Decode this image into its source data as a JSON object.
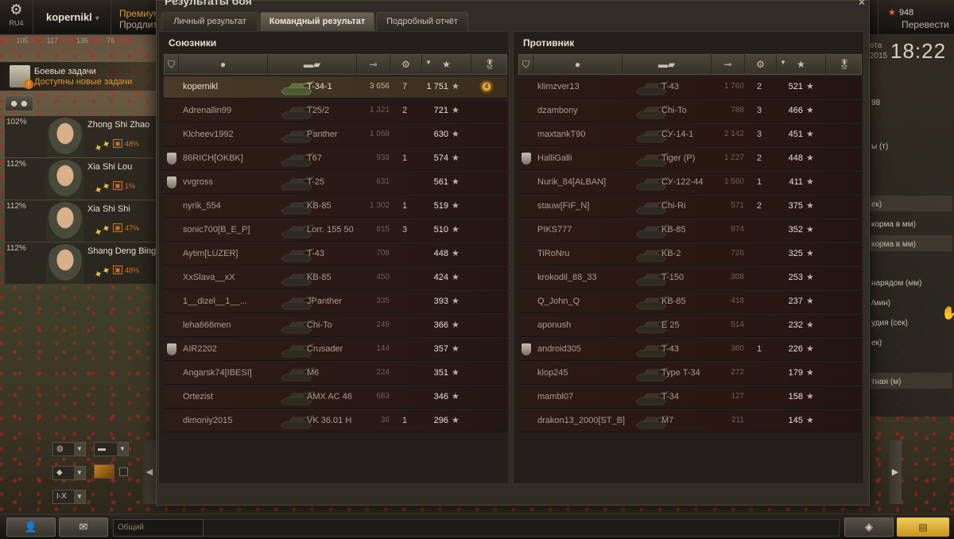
{
  "topbar": {
    "server_short": "RU4",
    "account_name": "kopernikl",
    "premium_title": "Премиум",
    "premium_sub": "Продлить",
    "gold_amount": "948",
    "convert_label": "Перевести"
  },
  "server_line": [
    "RU1",
    "105",
    "RU2",
    "117",
    "RU3",
    "136",
    "RU4",
    "76",
    "RU5"
  ],
  "missions": {
    "title": "Боевые задачи",
    "subtitle": "Доступны новые задачи",
    "badge": "!"
  },
  "crew": [
    {
      "pct": "102%",
      "name": "Zhong Shi Zhao",
      "skill": "48%"
    },
    {
      "pct": "112%",
      "name": "Xia Shi Lou",
      "skill": "1%"
    },
    {
      "pct": "112%",
      "name": "Xia Shi Shi",
      "skill": "47%"
    },
    {
      "pct": "112%",
      "name": "Shang Deng Bing",
      "skill": "48%"
    }
  ],
  "filters": {
    "level": "I-X"
  },
  "right_panel": {
    "clock_label": "ота",
    "clock_year": "2015",
    "clock": "18:22",
    "lines": [
      "98",
      "ы (т)",
      "ек)",
      "корма в мм)",
      "корма в мм)",
      "нарядом (мм)",
      "/мин)",
      "удия (сек)",
      "ек)",
      "тная (м)"
    ]
  },
  "bottombar": {
    "chat_placeholder": "Общий"
  },
  "window": {
    "title": "Результаты боя",
    "tabs": [
      "Личный результат",
      "Командный результат",
      "Подробный отчёт"
    ],
    "active_tab": 1
  },
  "allies": {
    "title": "Союзники",
    "rows": [
      {
        "player": "kopernikl",
        "tank": "T-34-1",
        "damage": "3 656",
        "kills": "7",
        "xp": "1 751",
        "clan_icon": false,
        "me": true,
        "medal": "4"
      },
      {
        "player": "Adrenallin99",
        "tank": "T25/2",
        "damage": "1 321",
        "kills": "2",
        "xp": "721",
        "clan_icon": false
      },
      {
        "player": "Klcheev1992",
        "tank": "Panther",
        "damage": "1 068",
        "kills": "",
        "xp": "630",
        "clan_icon": false
      },
      {
        "player": "86RICH[OKBK]",
        "tank": "T67",
        "damage": "938",
        "kills": "1",
        "xp": "574",
        "clan_icon": true
      },
      {
        "player": "vvgross",
        "tank": "T-25",
        "damage": "631",
        "kills": "",
        "xp": "561",
        "clan_icon": true
      },
      {
        "player": "nyrik_554",
        "tank": "KB-85",
        "damage": "1 302",
        "kills": "1",
        "xp": "519",
        "clan_icon": false
      },
      {
        "player": "sonic700[B_E_P]",
        "tank": "Lorr. 155 50",
        "damage": "815",
        "kills": "3",
        "xp": "510",
        "clan_icon": false
      },
      {
        "player": "Aytim[LUZER]",
        "tank": "T-43",
        "damage": "708",
        "kills": "",
        "xp": "448",
        "clan_icon": false
      },
      {
        "player": "XxSlava__xX",
        "tank": "KB-85",
        "damage": "450",
        "kills": "",
        "xp": "424",
        "clan_icon": false
      },
      {
        "player": "1__dizel__1__...",
        "tank": "JPanther",
        "damage": "335",
        "kills": "",
        "xp": "393",
        "clan_icon": false
      },
      {
        "player": "leha666men",
        "tank": "Chi-To",
        "damage": "249",
        "kills": "",
        "xp": "366",
        "clan_icon": false
      },
      {
        "player": "AIR2202",
        "tank": "Crusader",
        "damage": "144",
        "kills": "",
        "xp": "357",
        "clan_icon": true
      },
      {
        "player": "Angarsk74[IBESI]",
        "tank": "M6",
        "damage": "224",
        "kills": "",
        "xp": "351",
        "clan_icon": false
      },
      {
        "player": "Ortezist",
        "tank": "AMX AC 46",
        "damage": "683",
        "kills": "",
        "xp": "346",
        "clan_icon": false
      },
      {
        "player": "dimoniy2015",
        "tank": "VK 36.01 H",
        "damage": "36",
        "kills": "1",
        "xp": "296",
        "clan_icon": false
      }
    ]
  },
  "enemies": {
    "title": "Противник",
    "rows": [
      {
        "player": "klimzver13",
        "tank": "T-43",
        "damage": "1 760",
        "kills": "2",
        "xp": "521",
        "clan_icon": false
      },
      {
        "player": "dzambony",
        "tank": "Chi-To",
        "damage": "788",
        "kills": "3",
        "xp": "466",
        "clan_icon": false
      },
      {
        "player": "maxtankT90",
        "tank": "СУ-14-1",
        "damage": "2 142",
        "kills": "3",
        "xp": "451",
        "clan_icon": false
      },
      {
        "player": "HalliGalli",
        "tank": "Tiger (P)",
        "damage": "1 227",
        "kills": "2",
        "xp": "448",
        "clan_icon": true
      },
      {
        "player": "Nurik_84[ALBAN]",
        "tank": "СУ-122-44",
        "damage": "1 560",
        "kills": "1",
        "xp": "411",
        "clan_icon": false
      },
      {
        "player": "stauw[FIF_N]",
        "tank": "Chi-Ri",
        "damage": "571",
        "kills": "2",
        "xp": "375",
        "clan_icon": false
      },
      {
        "player": "PIKS777",
        "tank": "KB-85",
        "damage": "874",
        "kills": "",
        "xp": "352",
        "clan_icon": false
      },
      {
        "player": "TiRoNru",
        "tank": "KB-2",
        "damage": "726",
        "kills": "",
        "xp": "325",
        "clan_icon": false
      },
      {
        "player": "krokodil_88_33",
        "tank": "T-150",
        "damage": "308",
        "kills": "",
        "xp": "253",
        "clan_icon": false
      },
      {
        "player": "Q_John_Q",
        "tank": "KB-85",
        "damage": "418",
        "kills": "",
        "xp": "237",
        "clan_icon": false
      },
      {
        "player": "aponush",
        "tank": "E 25",
        "damage": "514",
        "kills": "",
        "xp": "232",
        "clan_icon": false
      },
      {
        "player": "android305",
        "tank": "T-43",
        "damage": "360",
        "kills": "1",
        "xp": "226",
        "clan_icon": true
      },
      {
        "player": "klop245",
        "tank": "Type T-34",
        "damage": "272",
        "kills": "",
        "xp": "179",
        "clan_icon": false
      },
      {
        "player": "mambl07",
        "tank": "T-34",
        "damage": "127",
        "kills": "",
        "xp": "158",
        "clan_icon": false
      },
      {
        "player": "drakon13_2000[ST_B]",
        "tank": "M7",
        "damage": "211",
        "kills": "",
        "xp": "145",
        "clan_icon": false
      }
    ]
  }
}
